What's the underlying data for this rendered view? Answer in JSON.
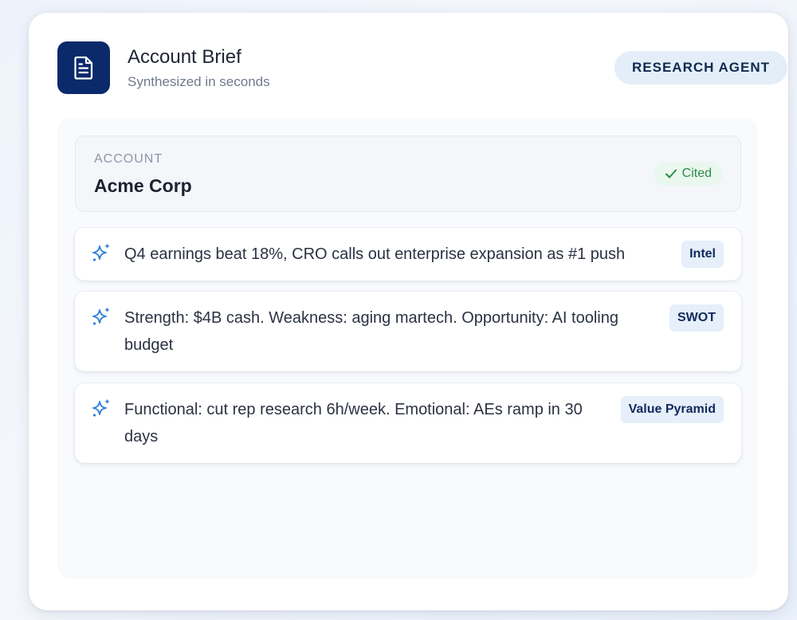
{
  "brief": {
    "title": "Account Brief",
    "subtitle": "Synthesized in seconds",
    "agent_label": "RESEARCH AGENT",
    "icon": "document-icon"
  },
  "account": {
    "label": "ACCOUNT",
    "name": "Acme Corp",
    "status": "Cited",
    "status_icon": "check-icon"
  },
  "facts": [
    {
      "text": "Q4 earnings beat 18%, CRO calls out enterprise expansion as #1 push",
      "tag": "Intel",
      "icon": "sparkle-icon"
    },
    {
      "text": "Strength: $4B cash. Weakness: aging martech. Opportunity: AI tooling budget",
      "tag": "SWOT",
      "icon": "sparkle-icon"
    },
    {
      "text": "Functional: cut rep research 6h/week. Emotional: AEs ramp in 30 days",
      "tag": "Value Pyramid",
      "icon": "sparkle-icon"
    }
  ],
  "colors": {
    "brand_navy": "#0b2a6b",
    "sparkle_blue": "#2f7fd9",
    "cited_green": "#2a8a4a",
    "tag_bg": "#e6effa"
  }
}
